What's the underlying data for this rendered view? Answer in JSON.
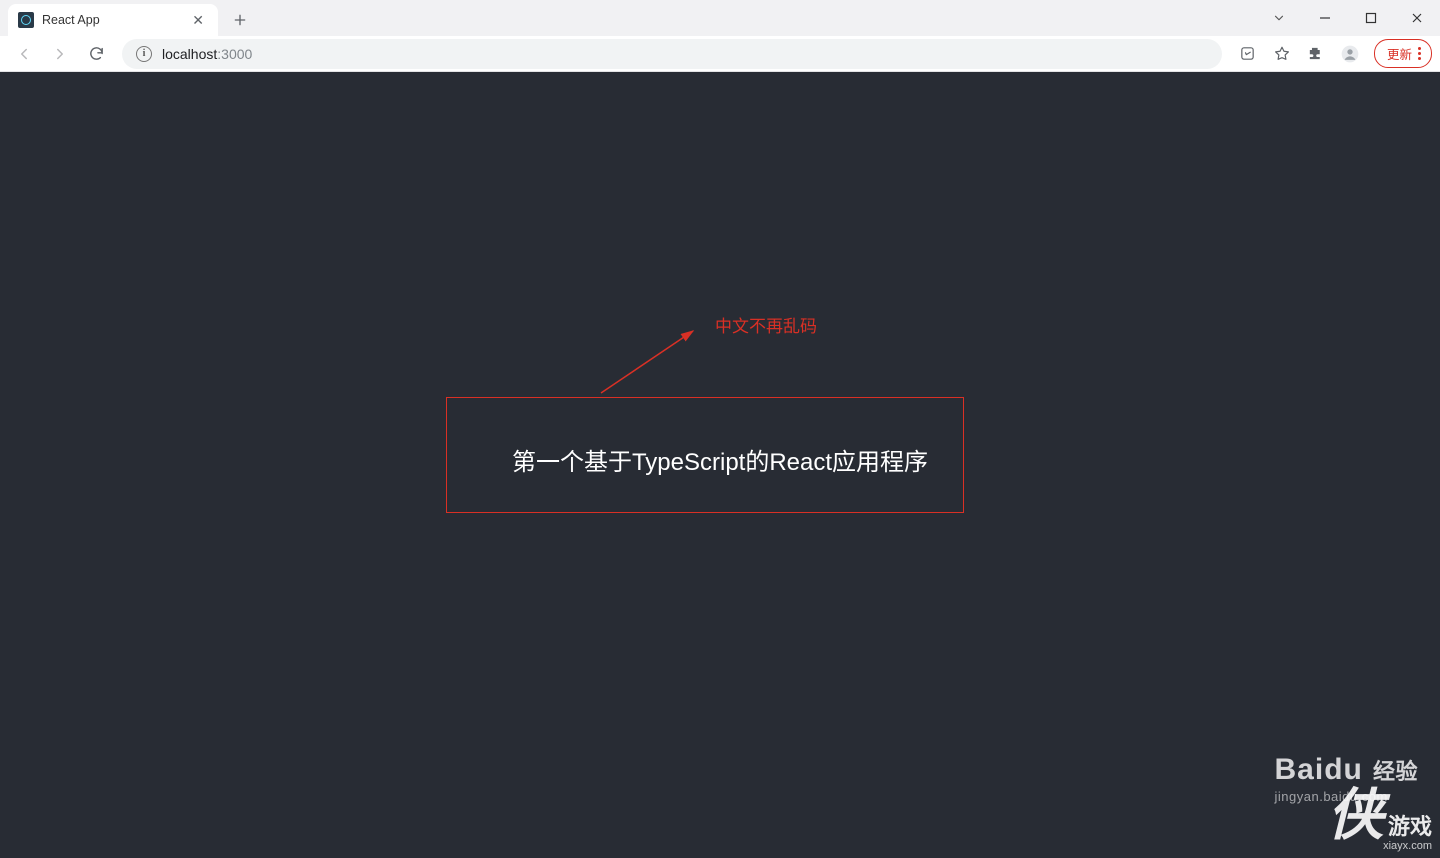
{
  "browser": {
    "tab_title": "React App",
    "url_host": "localhost",
    "url_port": ":3000",
    "update_label": "更新"
  },
  "page": {
    "heading": "第一个基于TypeScript的React应用程序"
  },
  "annotation": {
    "label": "中文不再乱码"
  },
  "watermark": {
    "baidu_brand": "Baidu",
    "baidu_suffix": "经验",
    "baidu_url": "jingyan.baidu.com",
    "xia_brand": "侠",
    "xia_suffix": "游戏",
    "xia_url": "xiayx.com"
  }
}
